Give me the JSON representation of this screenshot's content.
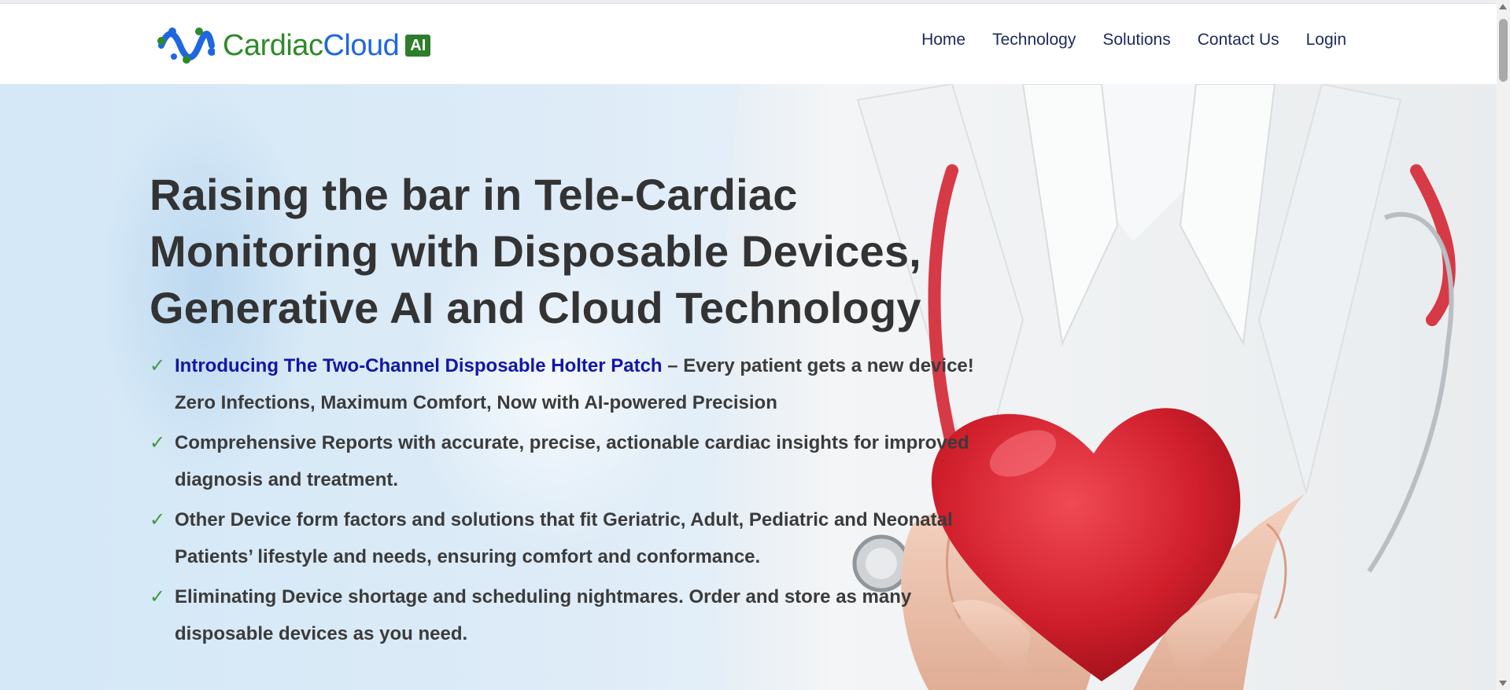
{
  "brand": {
    "name_part1": "Cardiac",
    "name_part2": "Cloud",
    "badge": "AI",
    "colors": {
      "green": "#2f8a2a",
      "blue": "#1f67e0"
    }
  },
  "nav": {
    "items": [
      {
        "label": "Home"
      },
      {
        "label": "Technology"
      },
      {
        "label": "Solutions"
      },
      {
        "label": "Contact Us"
      },
      {
        "label": "Login"
      }
    ]
  },
  "hero": {
    "title": "Raising the bar in Tele-Cardiac Monitoring with Disposable Devices, Generative AI and Cloud Technology",
    "bullets": [
      {
        "link": "Introducing The Two-Channel Disposable Holter Patch",
        "text": " – Every patient gets a new device! Zero Infections, Maximum Comfort, Now with AI-powered Precision"
      },
      {
        "text": "Comprehensive Reports with accurate, precise, actionable cardiac insights for improved diagnosis and treatment."
      },
      {
        "text": "Other Device form factors and solutions that fit Geriatric, Adult, Pediatric and Neonatal Patients’ lifestyle and needs, ensuring comfort and conformance."
      },
      {
        "text": "Eliminating Device shortage and scheduling nightmares. Order and store as many disposable devices as you need."
      }
    ],
    "check_icon": "check-icon",
    "image": "doctor-holding-red-heart"
  }
}
